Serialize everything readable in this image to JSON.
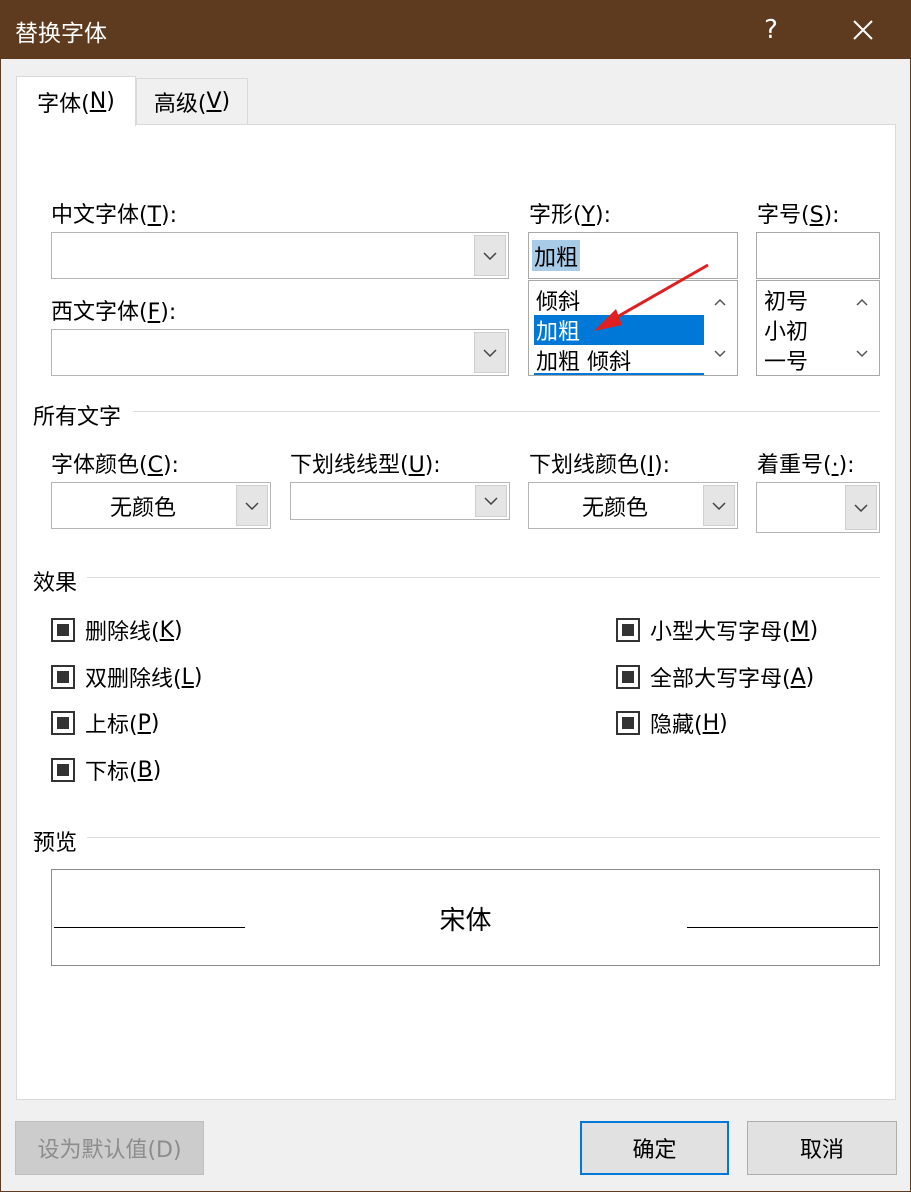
{
  "window": {
    "title": "替换字体",
    "help_label": "?"
  },
  "tabs": [
    {
      "label": "字体(",
      "key": "N",
      "suffix": ")"
    },
    {
      "label": "高级(",
      "key": "V",
      "suffix": ")"
    }
  ],
  "font": {
    "cn_label": "中文字体(",
    "cn_key": "T",
    "cn_suffix": "):",
    "west_label": "西文字体(",
    "west_key": "F",
    "west_suffix": "):",
    "cn_value": "",
    "west_value": ""
  },
  "style": {
    "label": "字形(",
    "key": "Y",
    "suffix": "):",
    "value": "加粗",
    "items": [
      "倾斜",
      "加粗",
      "加粗 倾斜"
    ]
  },
  "size": {
    "label": "字号(",
    "key": "S",
    "suffix": "):",
    "value": "",
    "items": [
      "初号",
      "小初",
      "一号"
    ]
  },
  "all_text": {
    "title": "所有文字",
    "color_label": "字体颜色(",
    "color_key": "C",
    "color_suffix": "):",
    "color_value": "无颜色",
    "uline_label": "下划线线型(",
    "uline_key": "U",
    "uline_suffix": "):",
    "uline_value": "",
    "ucolor_label": "下划线颜色(",
    "ucolor_key": "I",
    "ucolor_suffix": "):",
    "ucolor_value": "无颜色",
    "emph_label": "着重号(",
    "emph_key": "·",
    "emph_suffix": "):",
    "emph_value": ""
  },
  "effects": {
    "title": "效果",
    "strike": {
      "label": "删除线(",
      "key": "K",
      "suffix": ")"
    },
    "dstrike": {
      "label": "双删除线(",
      "key": "L",
      "suffix": ")"
    },
    "sup": {
      "label": "上标(",
      "key": "P",
      "suffix": ")"
    },
    "sub": {
      "label": "下标(",
      "key": "B",
      "suffix": ")"
    },
    "smallcaps": {
      "label": "小型大写字母(",
      "key": "M",
      "suffix": ")"
    },
    "allcaps": {
      "label": "全部大写字母(",
      "key": "A",
      "suffix": ")"
    },
    "hidden": {
      "label": "隐藏(",
      "key": "H",
      "suffix": ")"
    }
  },
  "preview": {
    "title": "预览",
    "sample": "宋体"
  },
  "buttons": {
    "set_default": "设为默认值(D)",
    "ok": "确定",
    "cancel": "取消"
  },
  "colors": {
    "titlebar": "#5e3b1e",
    "selection": "#0078d7",
    "annotation_arrow": "#e02020"
  }
}
